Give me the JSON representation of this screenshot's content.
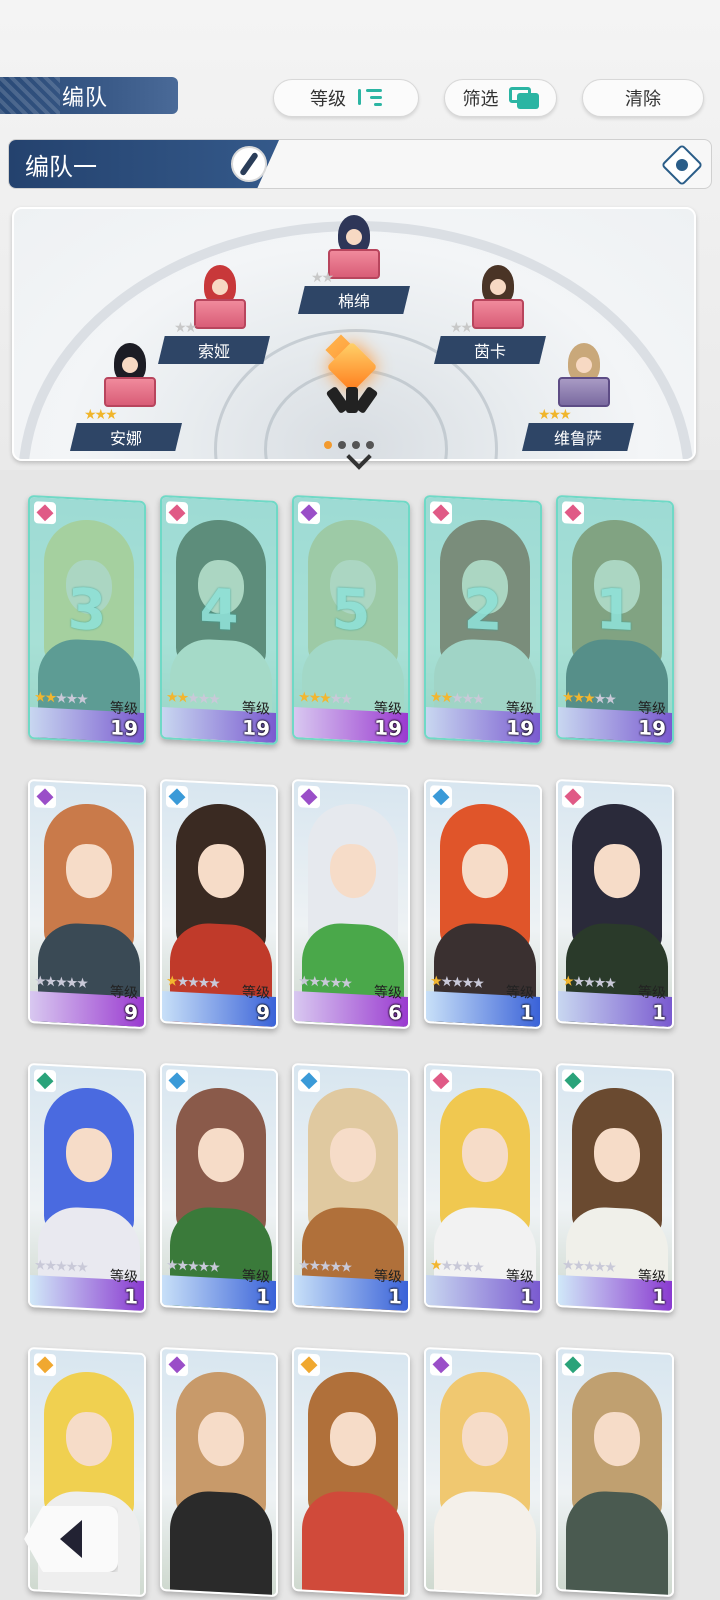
{
  "header": {
    "title": "编队",
    "sort_label": "等级",
    "filter_label": "筛选",
    "clear_label": "清除"
  },
  "team": {
    "name": "编队一"
  },
  "formation": {
    "members": [
      {
        "name": "棉绵",
        "stars": 2,
        "star_color": "grey"
      },
      {
        "name": "索娅",
        "stars": 2,
        "star_color": "grey"
      },
      {
        "name": "茵卡",
        "stars": 2,
        "star_color": "grey"
      },
      {
        "name": "安娜",
        "stars": 3,
        "star_color": "gold"
      },
      {
        "name": "维鲁萨",
        "stars": 3,
        "star_color": "gold"
      }
    ],
    "page_dots": 4,
    "active_dot": 1
  },
  "roster": {
    "level_label": "等级",
    "cards": [
      {
        "slot": "3",
        "level": "19",
        "element": "pink",
        "gold_stars": 2,
        "hair": "#e9cf7a",
        "outfit": "#4a5b63",
        "selected": true
      },
      {
        "slot": "4",
        "level": "19",
        "element": "pink",
        "gold_stars": 2,
        "hair": "#4a3a2a",
        "outfit": "#e9e4d5",
        "selected": true
      },
      {
        "slot": "5",
        "level": "19",
        "element": "purple",
        "gold_stars": 3,
        "hair": "#d8c28a",
        "outfit": "#e3e0d3",
        "selected": true
      },
      {
        "slot": "2",
        "level": "19",
        "element": "pink",
        "gold_stars": 2,
        "hair": "#8a3b2a",
        "outfit": "#ddd8d0",
        "selected": true
      },
      {
        "slot": "1",
        "level": "19",
        "element": "pink",
        "gold_stars": 3,
        "hair": "#9a6a3a",
        "outfit": "#3a3f4a",
        "selected": true
      },
      {
        "slot": "",
        "level": "9",
        "element": "purple",
        "gold_stars": 0,
        "hair": "#c97a4a",
        "outfit": "#3a4a55",
        "selected": false
      },
      {
        "slot": "",
        "level": "9",
        "element": "blue",
        "gold_stars": 1,
        "hair": "#3a2a22",
        "outfit": "#c03a2a",
        "selected": false
      },
      {
        "slot": "",
        "level": "6",
        "element": "purple",
        "gold_stars": 0,
        "hair": "#e6e9ee",
        "outfit": "#4aa84a",
        "selected": false
      },
      {
        "slot": "",
        "level": "1",
        "element": "blue",
        "gold_stars": 1,
        "hair": "#e0552a",
        "outfit": "#3a3030",
        "selected": false
      },
      {
        "slot": "",
        "level": "1",
        "element": "pink",
        "gold_stars": 1,
        "hair": "#2a2a3a",
        "outfit": "#2a3a2a",
        "selected": false
      },
      {
        "slot": "",
        "level": "1",
        "element": "green",
        "gold_stars": 0,
        "hair": "#4a6ae0",
        "outfit": "#e9e9f0",
        "selected": false
      },
      {
        "slot": "",
        "level": "1",
        "element": "blue",
        "gold_stars": 0,
        "hair": "#8a5a4a",
        "outfit": "#3a7a3a",
        "selected": false
      },
      {
        "slot": "",
        "level": "1",
        "element": "blue",
        "gold_stars": 0,
        "hair": "#e0c9a0",
        "outfit": "#b0703a",
        "selected": false
      },
      {
        "slot": "",
        "level": "1",
        "element": "pink",
        "gold_stars": 1,
        "hair": "#f0c850",
        "outfit": "#f2f2f2",
        "selected": false
      },
      {
        "slot": "",
        "level": "1",
        "element": "green",
        "gold_stars": 0,
        "hair": "#6a4a30",
        "outfit": "#f0f0ea",
        "selected": false
      },
      {
        "slot": "",
        "level": "",
        "element": "yellow",
        "gold_stars": 0,
        "hair": "#f0d050",
        "outfit": "#eeeeee",
        "selected": false
      },
      {
        "slot": "",
        "level": "",
        "element": "purple",
        "gold_stars": 0,
        "hair": "#c89a6a",
        "outfit": "#2a2a2a",
        "selected": false
      },
      {
        "slot": "",
        "level": "",
        "element": "yellow",
        "gold_stars": 0,
        "hair": "#b0703a",
        "outfit": "#d04a3a",
        "selected": false
      },
      {
        "slot": "",
        "level": "",
        "element": "purple",
        "gold_stars": 0,
        "hair": "#f0c870",
        "outfit": "#f4f0ea",
        "selected": false
      },
      {
        "slot": "",
        "level": "",
        "element": "green",
        "gold_stars": 0,
        "hair": "#c0a070",
        "outfit": "#4a5a50",
        "selected": false
      }
    ]
  },
  "colors": {
    "accent_teal": "#2bb5a3",
    "team_blue": "#24426e",
    "element_pink": "#e05a86",
    "element_purple": "#9a4ec8",
    "element_blue": "#3a9ad8",
    "element_green": "#2aa37a",
    "element_yellow": "#f0a830"
  }
}
